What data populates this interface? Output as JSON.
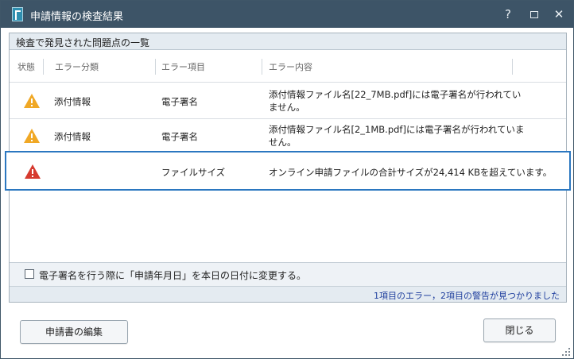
{
  "window": {
    "title": "申請情報の検査結果",
    "controls": {
      "help": "?",
      "close": "✕"
    }
  },
  "group": {
    "title": "検査で発見された問題点の一覧"
  },
  "table": {
    "columns": [
      "状態",
      "エラー分類",
      "エラー項目",
      "エラー内容"
    ],
    "rows": [
      {
        "status_icon": "warning-icon",
        "category": "添付情報",
        "item": "電子署名",
        "content_line1": "添付情報ファイル名[22_7MB.pdf]には電子署名が行われてい",
        "content_line2": "ません。"
      },
      {
        "status_icon": "warning-icon",
        "category": "添付情報",
        "item": "電子署名",
        "content_line1": "添付情報ファイル名[2_1MB.pdf]には電子署名が行われていま",
        "content_line2": "せん。"
      },
      {
        "status_icon": "error-icon",
        "category": "",
        "item": "ファイルサイズ",
        "content_line1": "オンライン申請ファイルの合計サイズが24,414 KBを超えています。",
        "content_line2": ""
      }
    ]
  },
  "checkbox": {
    "label": "電子署名を行う際に「申請年月日」を本日の日付に変更する。",
    "checked": false
  },
  "status": {
    "message": "1項目のエラー，2項目の警告が見つかりました"
  },
  "buttons": {
    "edit": "申請書の編集",
    "close": "閉じる"
  },
  "colors": {
    "titlebar": "#3d5467",
    "warning": "#f0a825",
    "error": "#d63a2f",
    "selection": "#2b77c0",
    "status_text": "#1f3f9e"
  }
}
